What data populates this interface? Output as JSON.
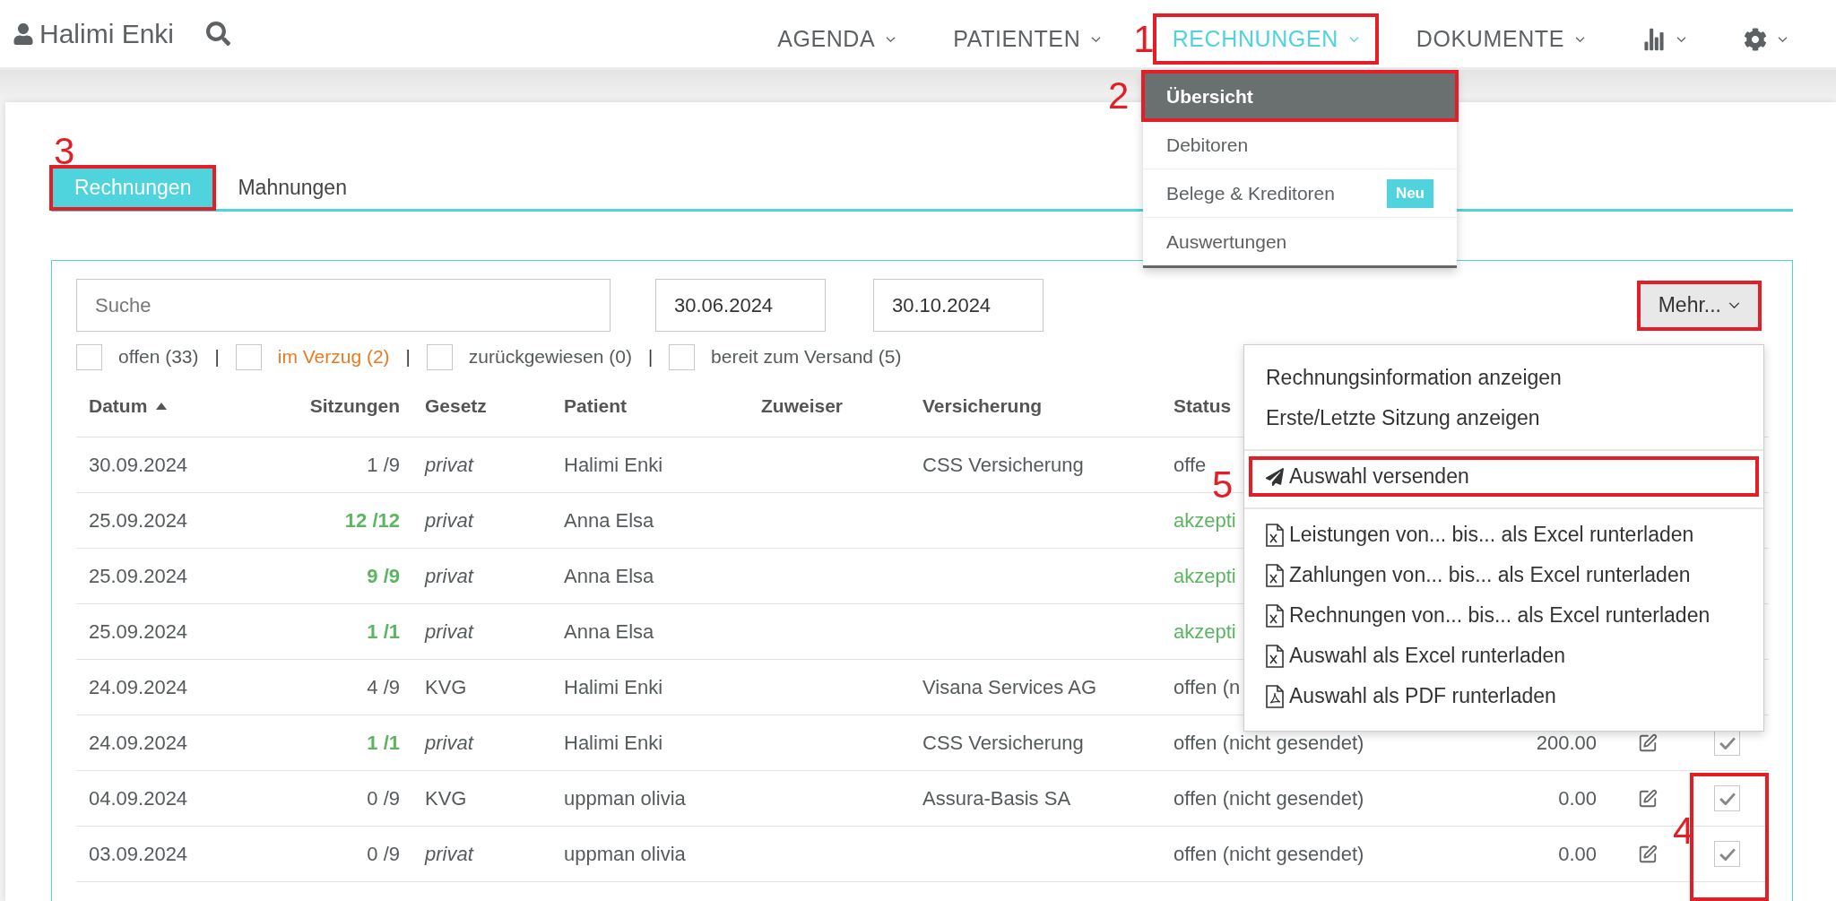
{
  "user": {
    "name": "Halimi Enki"
  },
  "nav": [
    {
      "kind": "text",
      "label": "AGENDA",
      "selected": false,
      "highlighted": false
    },
    {
      "kind": "text",
      "label": "PATIENTEN",
      "selected": false,
      "highlighted": false
    },
    {
      "kind": "text",
      "label": "RECHNUNGEN",
      "selected": true,
      "highlighted": true
    },
    {
      "kind": "text",
      "label": "DOKUMENTE",
      "selected": false,
      "highlighted": false
    },
    {
      "kind": "chart",
      "selected": false,
      "highlighted": false
    },
    {
      "kind": "gear",
      "selected": false,
      "highlighted": false
    }
  ],
  "nav_menu": [
    {
      "label": "Übersicht",
      "selected": true,
      "highlighted": true
    },
    {
      "label": "Debitoren",
      "selected": false,
      "highlighted": false
    },
    {
      "label": "Belege & Kreditoren",
      "badge": "Neu",
      "selected": false,
      "highlighted": false
    },
    {
      "label": "Auswertungen",
      "selected": false,
      "highlighted": false
    }
  ],
  "tabs": [
    {
      "label": "Rechnungen",
      "selected": true,
      "highlighted": true
    },
    {
      "label": "Mahnungen",
      "selected": false,
      "highlighted": false
    }
  ],
  "search": {
    "placeholder": "Suche"
  },
  "date_from": "30.06.2024",
  "date_to": "30.10.2024",
  "more_button": {
    "label": "Mehr...",
    "highlighted": true
  },
  "filters": [
    {
      "label": "offen (33)",
      "checked": false,
      "warning": false,
      "separator": "|"
    },
    {
      "label": "im Verzug (2)",
      "checked": false,
      "warning": true,
      "separator": "|"
    },
    {
      "label": "zurückgewiesen (0)",
      "checked": false,
      "warning": false,
      "separator": "|"
    },
    {
      "label": "bereit zum Versand (5)",
      "checked": false,
      "warning": false
    }
  ],
  "table": {
    "columns": [
      "Datum",
      "Sitzungen",
      "Gesetz",
      "Patient",
      "Zuweiser",
      "Versicherung",
      "Status"
    ],
    "rows": [
      {
        "datum": "30.09.2024",
        "sitzungen": "1 /9",
        "complete": false,
        "gesetz": "privat",
        "gesetz_italic": true,
        "patient": "Halimi Enki",
        "versicherung": "CSS Versicherung",
        "status": "offe",
        "accepted": false
      },
      {
        "datum": "25.09.2024",
        "sitzungen": "12 /12",
        "complete": true,
        "gesetz": "privat",
        "gesetz_italic": true,
        "patient": "Anna Elsa",
        "status": "akzepti",
        "accepted": true
      },
      {
        "datum": "25.09.2024",
        "sitzungen": "9 /9",
        "complete": true,
        "gesetz": "privat",
        "gesetz_italic": true,
        "patient": "Anna Elsa",
        "status": "akzepti",
        "accepted": true
      },
      {
        "datum": "25.09.2024",
        "sitzungen": "1 /1",
        "complete": true,
        "gesetz": "privat",
        "gesetz_italic": true,
        "patient": "Anna Elsa",
        "status": "akzepti",
        "accepted": true
      },
      {
        "datum": "24.09.2024",
        "sitzungen": "4 /9",
        "complete": false,
        "gesetz": "KVG",
        "gesetz_italic": false,
        "patient": "Halimi Enki",
        "versicherung": "Visana Services AG",
        "status": "offen (n",
        "accepted": false
      },
      {
        "datum": "24.09.2024",
        "sitzungen": "1 /1",
        "complete": true,
        "gesetz": "privat",
        "gesetz_italic": true,
        "patient": "Halimi Enki",
        "versicherung": "CSS Versicherung",
        "status": "offen (nicht gesendet)",
        "accepted": false,
        "betrag": "200.00",
        "editable": true,
        "checked": true
      },
      {
        "datum": "04.09.2024",
        "sitzungen": "0 /9",
        "complete": false,
        "gesetz": "KVG",
        "gesetz_italic": false,
        "patient": "uppman olivia",
        "versicherung": "Assura-Basis SA",
        "status": "offen (nicht gesendet)",
        "accepted": false,
        "betrag": "0.00",
        "editable": true,
        "checked": true
      },
      {
        "datum": "03.09.2024",
        "sitzungen": "0 /9",
        "complete": false,
        "gesetz": "privat",
        "gesetz_italic": true,
        "patient": "uppman olivia",
        "status": "offen (nicht gesendet)",
        "accepted": false,
        "betrag": "0.00",
        "editable": true,
        "checked": true
      }
    ]
  },
  "more_menu": [
    [
      {
        "label": "Rechnungsinformation anzeigen",
        "kind": "plain",
        "highlighted": false
      },
      {
        "label": "Erste/Letzte Sitzung anzeigen",
        "kind": "plain",
        "highlighted": false
      }
    ],
    [
      {
        "label": "Auswahl versenden",
        "kind": "send",
        "highlighted": true
      }
    ],
    [
      {
        "label": "Leistungen von... bis... als Excel runterladen",
        "kind": "excel",
        "highlighted": false
      },
      {
        "label": "Zahlungen von... bis... als Excel runterladen",
        "kind": "excel",
        "highlighted": false
      },
      {
        "label": "Rechnungen von... bis... als Excel runterladen",
        "kind": "excel",
        "highlighted": false
      },
      {
        "label": "Auswahl als Excel runterladen",
        "kind": "excel",
        "highlighted": false
      },
      {
        "label": "Auswahl als PDF runterladen",
        "kind": "pdf",
        "highlighted": false
      }
    ]
  ],
  "annotations": [
    "1",
    "2",
    "3",
    "4",
    "5"
  ]
}
